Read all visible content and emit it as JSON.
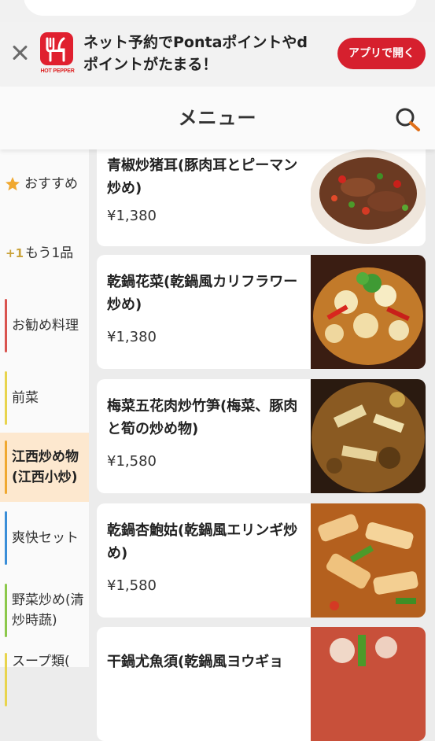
{
  "banner": {
    "message": "ネット予約でPontaポイントやdポイントがたまる！",
    "open_button": "アプリで開く",
    "logo_text": "HOT PEPPER"
  },
  "header": {
    "title": "メニュー"
  },
  "sidebar": {
    "items": [
      {
        "label": "おすすめ",
        "icon": "star-icon",
        "accent": "#f0a830"
      },
      {
        "label": "もう1品",
        "icon": "plus-one-icon",
        "icon_text": "+1",
        "accent": "#c9a23a"
      },
      {
        "label": "お勧め料理",
        "accent": "#d9534f"
      },
      {
        "label": "前菜",
        "accent": "#e8d44d"
      },
      {
        "label": "江西炒め物(江西小炒)",
        "accent": "#f0a830",
        "active": true
      },
      {
        "label": "爽快セット",
        "accent": "#3a8ed8"
      },
      {
        "label": "野菜炒め(清炒時蔬)",
        "accent": "#8cc84b"
      },
      {
        "label": "スープ類(",
        "accent": "#e8d44d"
      }
    ]
  },
  "menu": {
    "items": [
      {
        "name": "青椒炒猪耳(豚肉耳とピーマン炒め)",
        "price": "¥1,380"
      },
      {
        "name": "乾鍋花菜(乾鍋風カリフラワー炒め)",
        "price": "¥1,380"
      },
      {
        "name": "梅菜五花肉炒竹笋(梅菜、豚肉と筍の炒め物)",
        "price": "¥1,580"
      },
      {
        "name": "乾鍋杏鮑姑(乾鍋風エリンギ炒め)",
        "price": "¥1,580"
      },
      {
        "name": "干鍋尤魚須(乾鍋風ヨウギョ",
        "price": ""
      }
    ]
  },
  "colors": {
    "brand_red": "#d6202e",
    "active_bg": "#fde8cf"
  }
}
